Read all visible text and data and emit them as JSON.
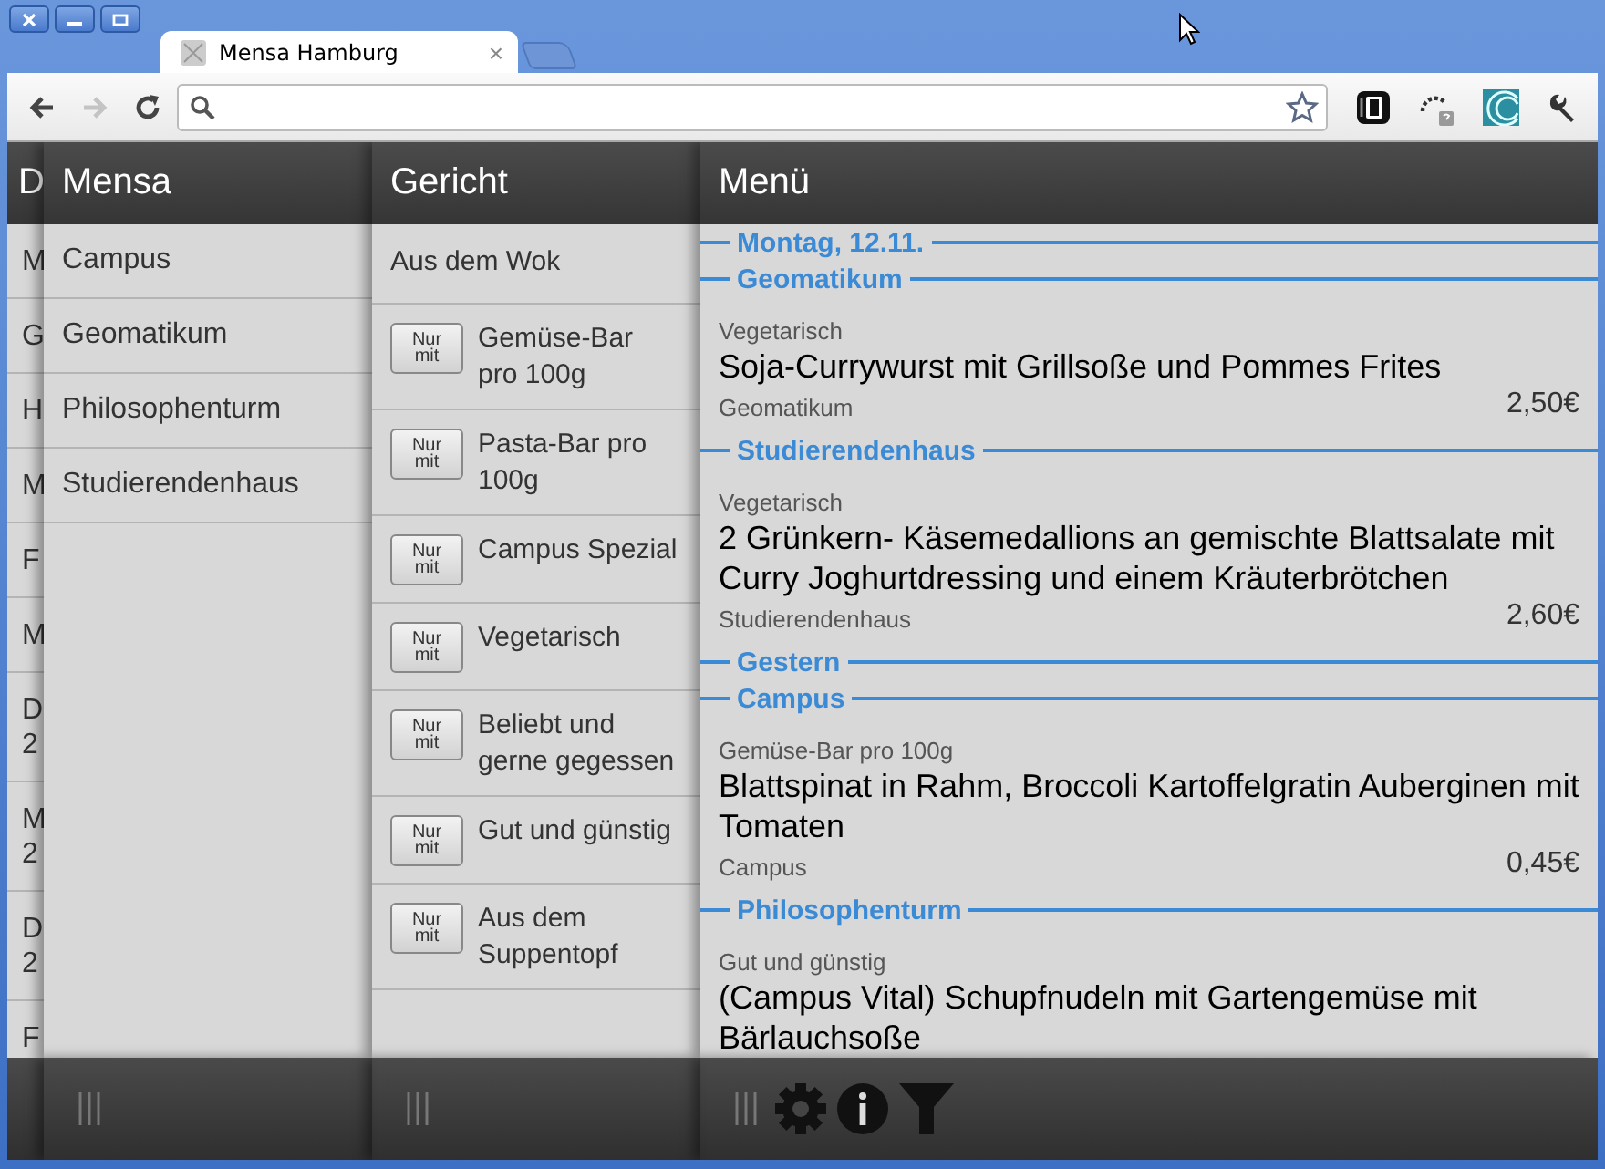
{
  "tab": {
    "title": "Mensa Hamburg",
    "close": "×"
  },
  "toolbar": {
    "nav": [
      {
        "kind": "back",
        "disabled": false
      },
      {
        "kind": "forward",
        "disabled": true
      },
      {
        "kind": "reload",
        "disabled": false
      }
    ]
  },
  "back_pane": {
    "header": "D",
    "rows": [
      [
        "M"
      ],
      [
        "G"
      ],
      [
        "H"
      ],
      [
        "M"
      ],
      [
        "F"
      ],
      [
        "M"
      ],
      [
        "D",
        "2"
      ],
      [
        "M",
        "2"
      ],
      [
        "D",
        "2"
      ],
      [
        "F"
      ]
    ]
  },
  "mensa_pane": {
    "header": "Mensa",
    "items": [
      "Campus",
      "Geomatikum",
      "Philosophenturm",
      "Studierendenhaus"
    ]
  },
  "gericht_pane": {
    "header": "Gericht",
    "items": [
      {
        "kind": "plain",
        "label": "Aus dem Wok"
      },
      {
        "kind": "filter",
        "button": "Nur mit",
        "label": "Gemüse-Bar pro 100g"
      },
      {
        "kind": "filter",
        "button": "Nur mit",
        "label": "Pasta-Bar pro 100g"
      },
      {
        "kind": "filter",
        "button": "Nur mit",
        "label": "Campus Spezial"
      },
      {
        "kind": "filter",
        "button": "Nur mit",
        "label": "Vegetarisch"
      },
      {
        "kind": "filter",
        "button": "Nur mit",
        "label": "Beliebt und gerne gegessen"
      },
      {
        "kind": "filter",
        "button": "Nur mit",
        "label": "Gut und günstig"
      },
      {
        "kind": "filter",
        "button": "Nur mit",
        "label": "Aus dem Suppentopf"
      }
    ]
  },
  "menu_pane": {
    "header": "Menü",
    "entries": [
      {
        "kind": "separator",
        "label": "Montag, 12.11."
      },
      {
        "kind": "separator",
        "label": "Geomatikum"
      },
      {
        "kind": "dish",
        "category": "Vegetarisch",
        "name": "Soja-Currywurst mit Grillsoße und Pommes Frites",
        "location": "Geomatikum",
        "price": "2,50€"
      },
      {
        "kind": "separator",
        "label": "Studierendenhaus"
      },
      {
        "kind": "dish",
        "category": "Vegetarisch",
        "name": "2 Grünkern- Käsemedallions an gemischte Blattsalate mit Curry Joghurtdressing und einem Kräuterbrötchen",
        "location": "Studierendenhaus",
        "price": "2,60€"
      },
      {
        "kind": "separator",
        "label": "Gestern"
      },
      {
        "kind": "separator",
        "label": "Campus"
      },
      {
        "kind": "dish",
        "category": "Gemüse-Bar pro 100g",
        "name": "Blattspinat in Rahm, Broccoli Kartoffelgratin Auberginen mit Tomaten",
        "location": "Campus",
        "price": "0,45€"
      },
      {
        "kind": "separator",
        "label": "Philosophenturm"
      },
      {
        "kind": "dish",
        "category": "Gut und günstig",
        "name": "(Campus Vital) Schupfnudeln mit Gartengemüse mit Bärlauchsoße"
      }
    ]
  }
}
